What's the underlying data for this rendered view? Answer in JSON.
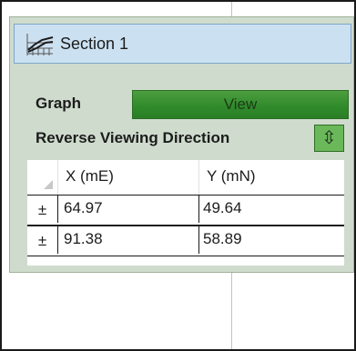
{
  "section": {
    "title": "Section 1",
    "icon": "section-graph-icon"
  },
  "graph": {
    "label": "Graph",
    "button_label": "View"
  },
  "reverse": {
    "label": "Reverse Viewing Direction",
    "button_glyph": "⇳",
    "icon": "reverse-direction-icon"
  },
  "table": {
    "columns": [
      "X (mE)",
      "Y (mN)"
    ],
    "rows": [
      {
        "expand": "±",
        "x": "64.97",
        "y": "49.64"
      },
      {
        "expand": "±",
        "x": "91.38",
        "y": "58.89"
      }
    ]
  },
  "colors": {
    "header_bg": "#cbe0f1",
    "panel_bg": "#cfdccd",
    "accent_green": "#2f8a2a"
  }
}
